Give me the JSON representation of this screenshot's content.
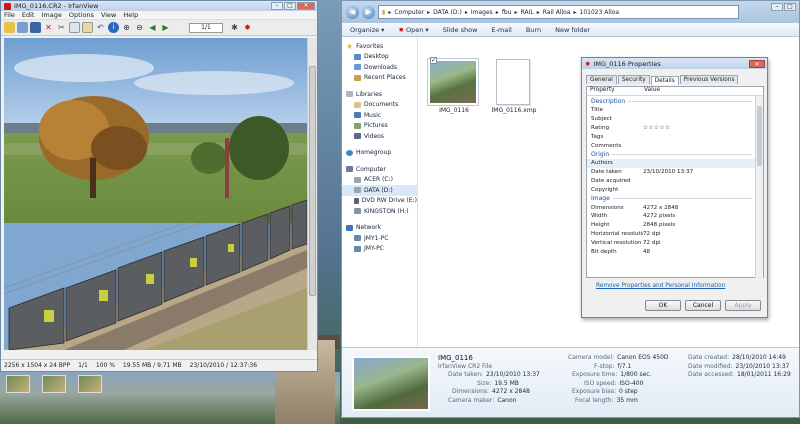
{
  "irfanview": {
    "title": "IMG_0116.CR2 - IrfanView",
    "menu": [
      "File",
      "Edit",
      "Image",
      "Options",
      "View",
      "Help"
    ],
    "page_field": "1/1",
    "status": [
      "2256 x 1504 x 24 BPP",
      "1/1",
      "100 %",
      "19.55 MB / 9.71 MB",
      "23/10/2010 / 12:37:36"
    ]
  },
  "explorer": {
    "breadcrumb": [
      "Computer",
      "DATA (D:)",
      "Images",
      "fbu",
      "RAIL",
      "Rail Alloa",
      "101023 Alloa"
    ],
    "commands": [
      "Organize ▾",
      "Open ▾",
      "Slide show",
      "E-mail",
      "Burn",
      "New folder"
    ],
    "nav": {
      "favorites_label": "Favorites",
      "favorites": [
        "Desktop",
        "Downloads",
        "Recent Places"
      ],
      "libraries_label": "Libraries",
      "libraries": [
        "Documents",
        "Music",
        "Pictures",
        "Videos"
      ],
      "homegroup_label": "Homegroup",
      "computer_label": "Computer",
      "drives": [
        "ACER (C:)",
        "DATA (D:)",
        "DVD RW Drive (E:)",
        "KINGSTON (H:)"
      ],
      "network_label": "Network",
      "network": [
        "JMY1-PC",
        "JMY-PC"
      ]
    },
    "files": [
      {
        "name": "IMG_0116"
      },
      {
        "name": "IMG_0116.xmp"
      }
    ],
    "details": {
      "name": "IMG_0116",
      "type": "IrfanView CR2 File",
      "col1": [
        {
          "k": "Date taken:",
          "v": "23/10/2010 13:37"
        },
        {
          "k": "Size:",
          "v": "19.5 MB"
        },
        {
          "k": "Dimensions:",
          "v": "4272 x 2848"
        },
        {
          "k": "Camera maker:",
          "v": "Canon"
        }
      ],
      "col2": [
        {
          "k": "Camera model:",
          "v": "Canon EOS 450D"
        },
        {
          "k": "F-stop:",
          "v": "f/7.1"
        },
        {
          "k": "Exposure time:",
          "v": "1/800 sec."
        },
        {
          "k": "ISO speed:",
          "v": "ISO-400"
        },
        {
          "k": "Exposure bias:",
          "v": "0 step"
        },
        {
          "k": "Focal length:",
          "v": "35 mm"
        }
      ],
      "col3": [
        {
          "k": "Date created:",
          "v": "28/10/2010 14:49"
        },
        {
          "k": "Date modified:",
          "v": "23/10/2010 13:37"
        },
        {
          "k": "Date accessed:",
          "v": "18/01/2011 16:29"
        }
      ]
    }
  },
  "properties": {
    "title": "IMG_0116 Properties",
    "tabs": [
      "General",
      "Security",
      "Details",
      "Previous Versions"
    ],
    "col_property": "Property",
    "col_value": "Value",
    "sections": {
      "description": "Description",
      "origin": "Origin",
      "image": "Image"
    },
    "description_rows": [
      {
        "k": "Title",
        "v": ""
      },
      {
        "k": "Subject",
        "v": ""
      },
      {
        "k": "Rating",
        "v": "☆☆☆☆☆"
      },
      {
        "k": "Tags",
        "v": ""
      },
      {
        "k": "Comments",
        "v": ""
      }
    ],
    "origin_rows": [
      {
        "k": "Authors",
        "v": ""
      },
      {
        "k": "Date taken",
        "v": "23/10/2010 13:37"
      },
      {
        "k": "Date acquired",
        "v": ""
      },
      {
        "k": "Copyright",
        "v": ""
      }
    ],
    "image_rows": [
      {
        "k": "Dimensions",
        "v": "4272 x 2848"
      },
      {
        "k": "Width",
        "v": "4272 pixels"
      },
      {
        "k": "Height",
        "v": "2848 pixels"
      },
      {
        "k": "Horizontal resolution",
        "v": "72 dpi"
      },
      {
        "k": "Vertical resolution",
        "v": "72 dpi"
      },
      {
        "k": "Bit depth",
        "v": "48"
      }
    ],
    "remove_link": "Remove Properties and Personal Information",
    "ok": "OK",
    "cancel": "Cancel",
    "apply": "Apply"
  }
}
